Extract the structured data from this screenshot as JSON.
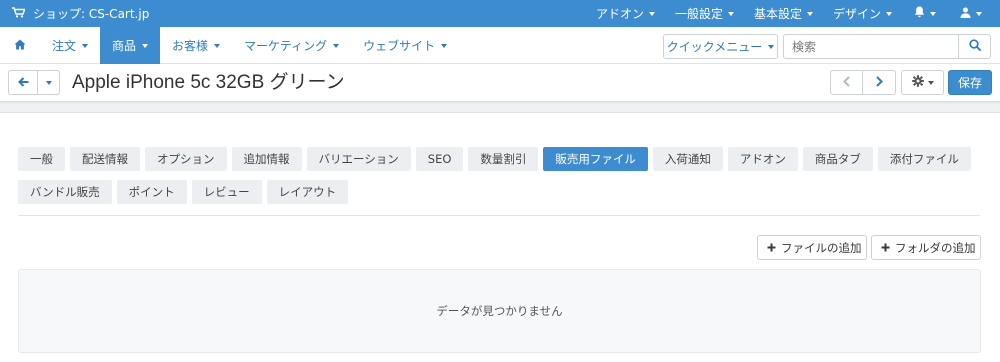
{
  "topbar": {
    "store_name": "ショップ: CS-Cart.jp",
    "menus": [
      {
        "label": "アドオン"
      },
      {
        "label": "一般設定"
      },
      {
        "label": "基本設定"
      },
      {
        "label": "デザイン"
      }
    ]
  },
  "nav": {
    "items": [
      {
        "label": "注文"
      },
      {
        "label": "商品"
      },
      {
        "label": "お客様"
      },
      {
        "label": "マーケティング"
      },
      {
        "label": "ウェブサイト"
      }
    ],
    "active_item": "商品",
    "quick_menu_label": "クイックメニュー",
    "search_placeholder": "検索"
  },
  "titlebar": {
    "title": "Apple iPhone 5c 32GB グリーン",
    "save_label": "保存"
  },
  "tabs": [
    {
      "label": "一般"
    },
    {
      "label": "配送情報"
    },
    {
      "label": "オプション"
    },
    {
      "label": "追加情報"
    },
    {
      "label": "バリエーション"
    },
    {
      "label": "SEO"
    },
    {
      "label": "数量割引"
    },
    {
      "label": "販売用ファイル"
    },
    {
      "label": "入荷通知"
    },
    {
      "label": "アドオン"
    },
    {
      "label": "商品タブ"
    },
    {
      "label": "添付ファイル"
    },
    {
      "label": "バンドル販売"
    },
    {
      "label": "ポイント"
    },
    {
      "label": "レビュー"
    },
    {
      "label": "レイアウト"
    }
  ],
  "active_tab": "販売用ファイル",
  "actions": {
    "add_file": "ファイルの追加",
    "add_folder": "フォルダの追加"
  },
  "empty_message": "データが見つかりません",
  "colors": {
    "accent": "#3d8ccf",
    "link": "#2f7bc0",
    "tab_bg": "#eceff2"
  }
}
